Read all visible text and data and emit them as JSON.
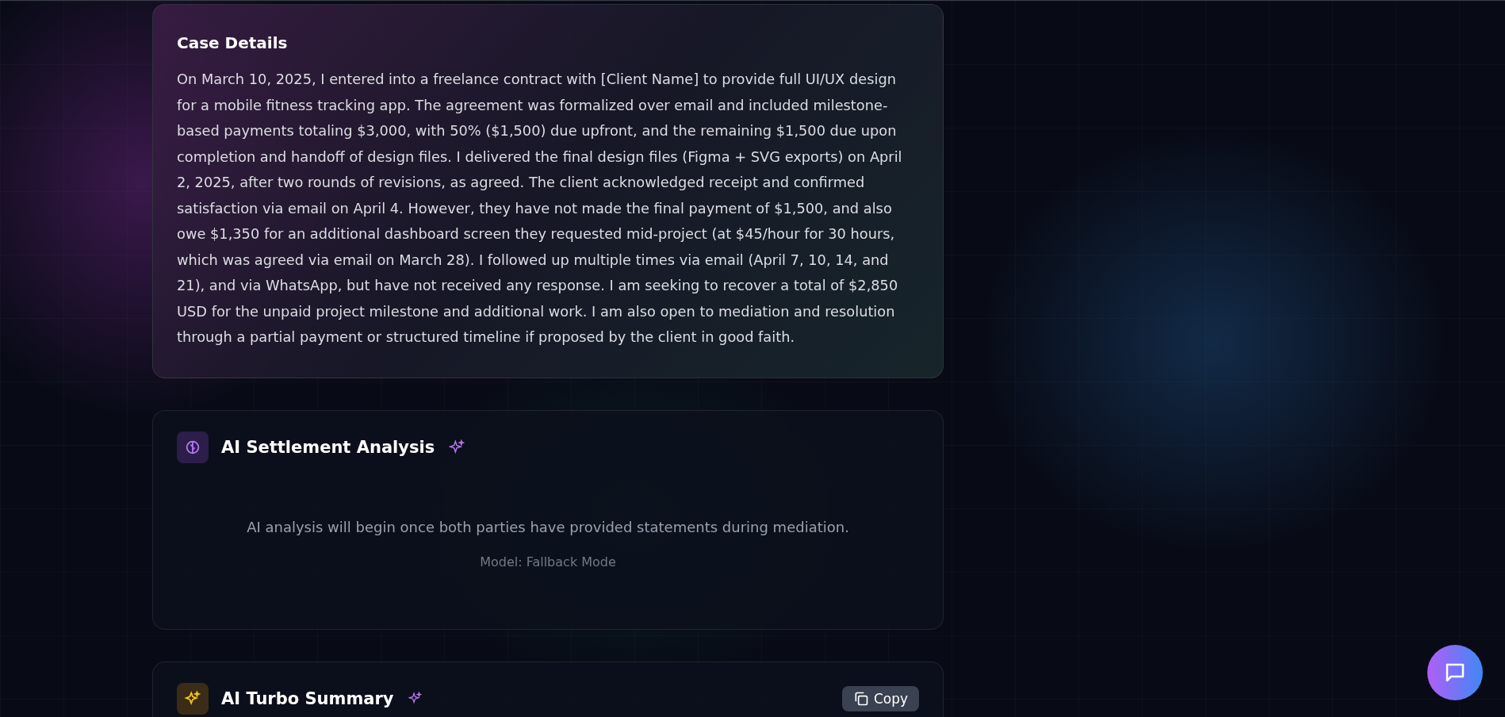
{
  "case_details": {
    "title": "Case Details",
    "body": "On March 10, 2025, I entered into a freelance contract with [Client Name] to provide full UI/UX design for a mobile fitness tracking app. The agreement was formalized over email and included milestone-based payments totaling $3,000, with 50% ($1,500) due upfront, and the remaining $1,500 due upon completion and handoff of design files. I delivered the final design files (Figma + SVG exports) on April 2, 2025, after two rounds of revisions, as agreed. The client acknowledged receipt and confirmed satisfaction via email on April 4. However, they have not made the final payment of $1,500, and also owe $1,350 for an additional dashboard screen they requested mid-project (at $45/hour for 30 hours, which was agreed via email on March 28). I followed up multiple times via email (April 7, 10, 14, and 21), and via WhatsApp, but have not received any response. I am seeking to recover a total of $2,850 USD for the unpaid project milestone and additional work. I am also open to mediation and resolution through a partial payment or structured timeline if proposed by the client in good faith."
  },
  "settlement_analysis": {
    "title": "AI Settlement Analysis",
    "message": "AI analysis will begin once both parties have provided statements during mediation.",
    "model": "Model: Fallback Mode"
  },
  "turbo_summary": {
    "title": "AI Turbo Summary",
    "copy_button": "Copy"
  }
}
